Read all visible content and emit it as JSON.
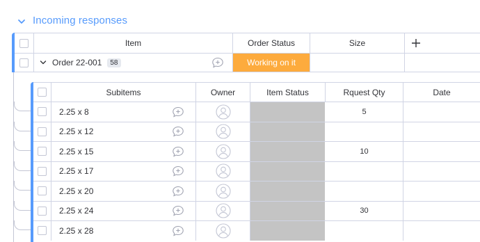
{
  "group": {
    "title": "Incoming responses"
  },
  "main_table": {
    "columns": {
      "item": "Item",
      "order_status": "Order Status",
      "size": "Size",
      "add": "+"
    },
    "row": {
      "name": "Order 22-001",
      "subitem_count": "58",
      "order_status": "Working on it",
      "order_status_color": "#fdab3d"
    }
  },
  "sub_table": {
    "columns": {
      "subitems": "Subitems",
      "owner": "Owner",
      "item_status": "Item Status",
      "qty": "Rquest Qty",
      "date": "Date"
    },
    "rows": [
      {
        "name": "2.25 x 8",
        "qty": "5"
      },
      {
        "name": "2.25 x 12",
        "qty": ""
      },
      {
        "name": "2.25 x 15",
        "qty": "10"
      },
      {
        "name": "2.25 x 17",
        "qty": ""
      },
      {
        "name": "2.25 x 20",
        "qty": ""
      },
      {
        "name": "2.25 x 24",
        "qty": "30"
      },
      {
        "name": "2.25 x 28",
        "qty": ""
      }
    ],
    "item_status_color": "#c4c4c4"
  },
  "icons": {
    "group_toggle": "chevron-down-icon",
    "expand": "chevron-down-icon",
    "updates": "chat-plus-icon",
    "owner": "person-circle-icon",
    "add_column": "plus-icon"
  }
}
